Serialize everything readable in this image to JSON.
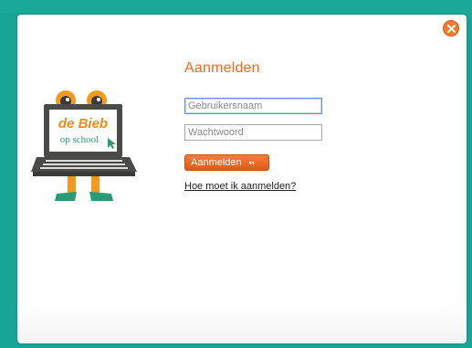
{
  "login": {
    "title": "Aanmelden",
    "username_placeholder": "Gebruikersnaam",
    "password_placeholder": "Wachtwoord",
    "submit_label": "Aanmelden",
    "help_link": "Hoe moet ik aanmelden?"
  },
  "logo": {
    "line1": "de Bieb",
    "line2": "op school"
  },
  "colors": {
    "accent": "#ee6a1c",
    "backdrop": "#17a596",
    "logo_green": "#2a9a78"
  },
  "icons": {
    "close": "close-icon",
    "arrow": "chevron-right-icon",
    "cursor": "mouse-cursor-icon"
  }
}
